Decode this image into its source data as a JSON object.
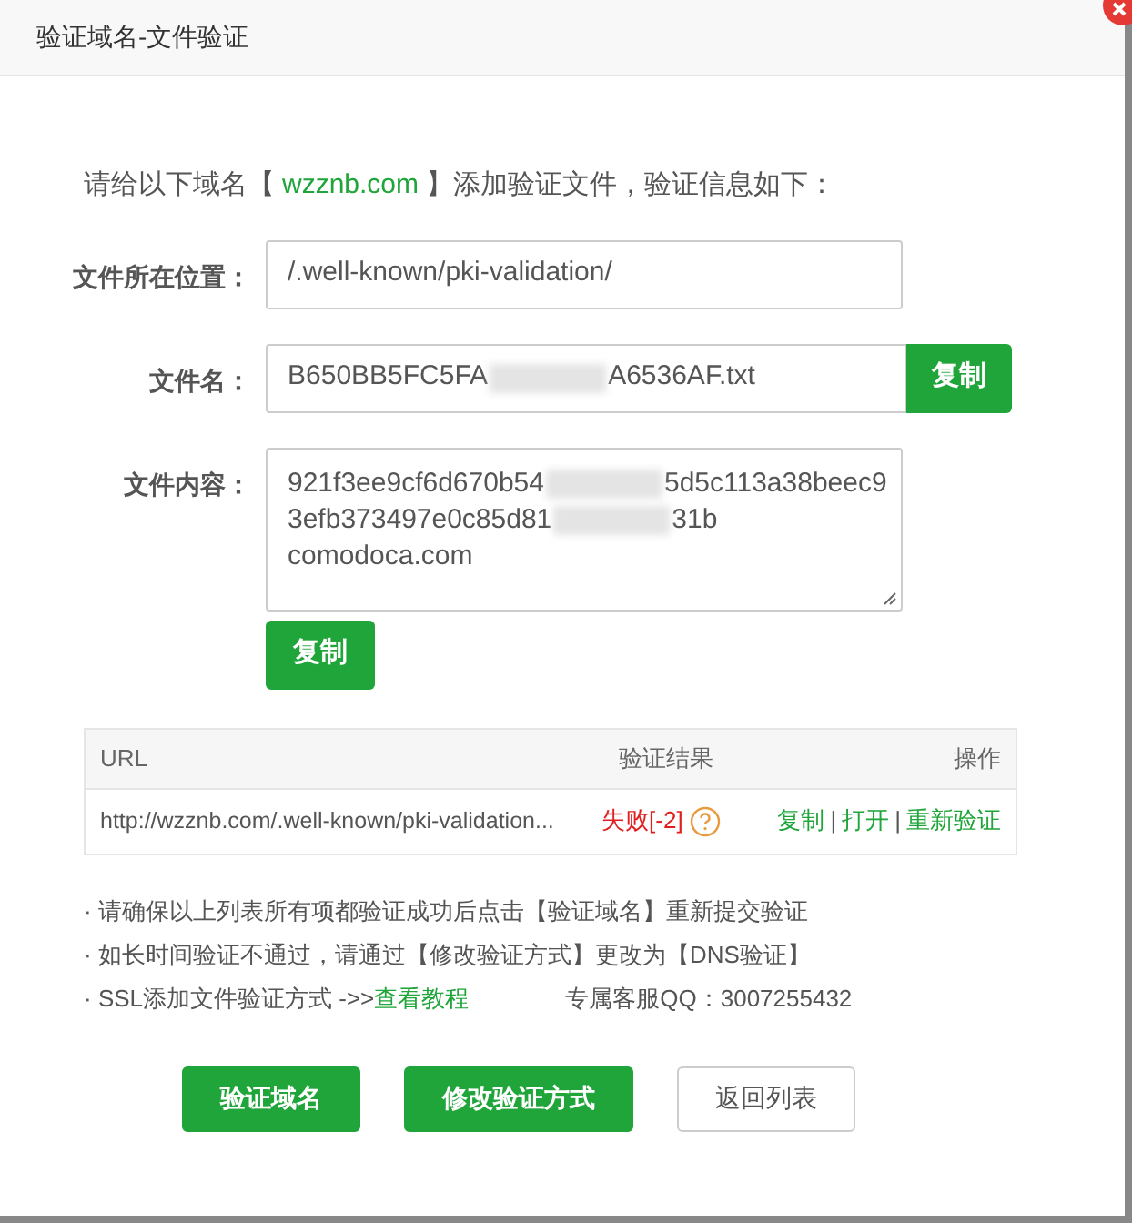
{
  "dialog": {
    "title": "验证域名-文件验证"
  },
  "intro": {
    "prefix": "请给以下域名【",
    "domain": "wzznb.com",
    "suffix": "】添加验证文件，验证信息如下："
  },
  "fields": [
    {
      "kind": "input",
      "label": "文件所在位置：",
      "parts": [
        "/.well-known/pki-validation/"
      ]
    },
    {
      "kind": "input-copy",
      "label": "文件名：",
      "parts": [
        "B650BB5FC5FA",
        "A6536AF.txt"
      ],
      "button": "复制"
    },
    {
      "kind": "textarea",
      "label": "文件内容：",
      "lines": [
        [
          "921f3ee9cf6d670b54",
          "5d5c113a38beec9"
        ],
        [
          "3efb373497e0c85d81",
          "31b"
        ],
        [
          "comodoca.com"
        ]
      ],
      "button": "复制"
    }
  ],
  "table": {
    "columns": [
      "URL",
      "验证结果",
      "操作"
    ],
    "rows": [
      {
        "url": "http://wzznb.com/.well-known/pki-validation...",
        "result": "失败[-2]",
        "failed": true,
        "actions": [
          "复制",
          "打开",
          "重新验证"
        ],
        "separator": "|"
      }
    ]
  },
  "notes": [
    {
      "text": "· 请确保以上列表所有项都验证成功后点击【验证域名】重新提交验证"
    },
    {
      "text": "· 如长时间验证不通过，请通过【修改验证方式】更改为【DNS验证】"
    },
    {
      "text": "· SSL添加文件验证方式 ->> ",
      "link": "查看教程",
      "extra": "专属客服QQ：3007255432"
    }
  ],
  "buttons": [
    {
      "label": "验证域名",
      "primary": true
    },
    {
      "label": "修改验证方式",
      "primary": true
    },
    {
      "label": "返回列表",
      "primary": false
    }
  ]
}
